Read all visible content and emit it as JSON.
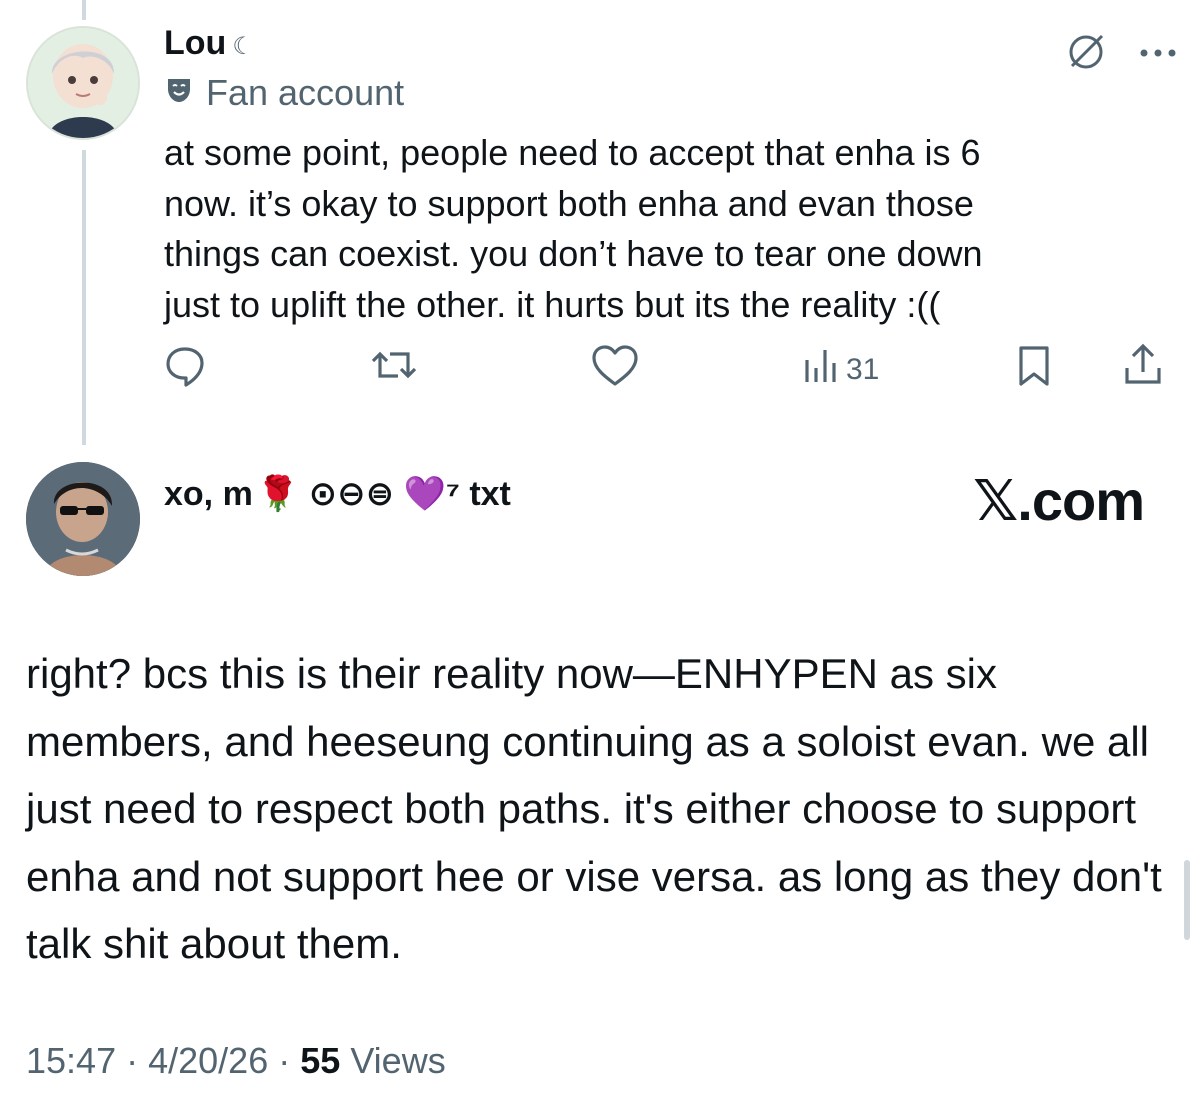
{
  "parent_tweet": {
    "author_name": "Lou",
    "name_suffix": "☾",
    "affiliation": "Fan account",
    "text": "at some point, people need to accept that enha is 6\nnow. it’s okay to support both enha and evan those\nthings can coexist. you don’t have to tear one down\njust to uplift the other. it hurts but its the reality :((",
    "actions": {
      "views_count": "31"
    }
  },
  "reply_tweet": {
    "author_name": "xo, m",
    "author_badges": "🌹 ⊙⊖⊜ 💜⁷ txt",
    "text": "right? bcs this is their reality now—ENHYPEN as six members, and heeseung continuing as a soloist evan. we all just need to respect both paths. it's either choose to support enha and not support hee or vise versa. as long as they don't talk shit about them.",
    "time": "15:47",
    "date": "4/20/26",
    "views_count": "55",
    "views_label": "Views"
  },
  "watermark": "𝕏.com",
  "colors": {
    "text": "#0f1419",
    "secondary": "#536471",
    "thread_line": "#cfd9de"
  },
  "icons": [
    "moon-icon",
    "theater-mask-icon",
    "grok-icon",
    "more-icon",
    "reply-icon",
    "retweet-icon",
    "like-icon",
    "views-icon",
    "bookmark-icon",
    "share-icon"
  ]
}
